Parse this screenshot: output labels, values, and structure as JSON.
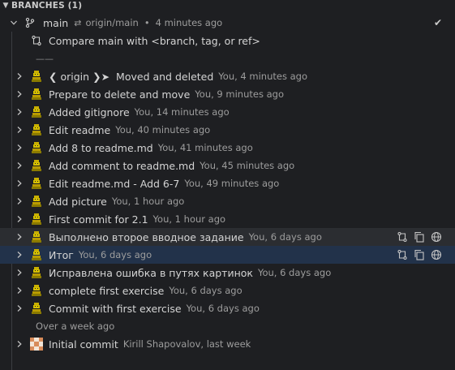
{
  "section": {
    "title": "BRANCHES (1)"
  },
  "branch": {
    "name": "main",
    "upstream": "origin/main",
    "separator": "•",
    "time": "4 minutes ago",
    "status_icon": "check-icon"
  },
  "compare": {
    "label": "Compare main with <branch, tag, or ref>"
  },
  "divider_label": "——",
  "ref_tag": {
    "open": "❮",
    "name": "origin",
    "close": "❯",
    "arrow": "➤"
  },
  "commits": [
    {
      "message": "Moved and deleted",
      "meta": "You, 4 minutes ago"
    },
    {
      "message": "Prepare to delete and move",
      "meta": "You, 9 minutes ago"
    },
    {
      "message": "Added gitignore",
      "meta": "You, 14 minutes ago"
    },
    {
      "message": "Edit readme",
      "meta": "You, 40 minutes ago"
    },
    {
      "message": "Add 8 to readme.md",
      "meta": "You, 41 minutes ago"
    },
    {
      "message": "Add comment to readme.md",
      "meta": "You, 45 minutes ago"
    },
    {
      "message": "Edit readme.md - Add 6-7",
      "meta": "You, 49 minutes ago"
    },
    {
      "message": "Add picture",
      "meta": "You, 1 hour ago"
    },
    {
      "message": "First commit for 2.1",
      "meta": "You, 1 hour ago"
    },
    {
      "message": "Выполнено второе вводное задание",
      "meta": "You, 6 days ago"
    },
    {
      "message": "Итог",
      "meta": "You, 6 days ago"
    },
    {
      "message": "Исправлена ошибка в путях картинок",
      "meta": "You, 6 days ago"
    },
    {
      "message": "complete first exercise",
      "meta": "You, 6 days ago"
    },
    {
      "message": "Commit with first exercise",
      "meta": "You, 6 days ago"
    }
  ],
  "group_label": "Over a week ago",
  "old_commit": {
    "message": "Initial commit",
    "meta": "Kirill Shapovalov, last week"
  },
  "colors": {
    "background": "#1e1f22",
    "selected_row": "#22324a",
    "hover_row": "#2b2d31",
    "avatar_yellow": "#c9b000"
  }
}
